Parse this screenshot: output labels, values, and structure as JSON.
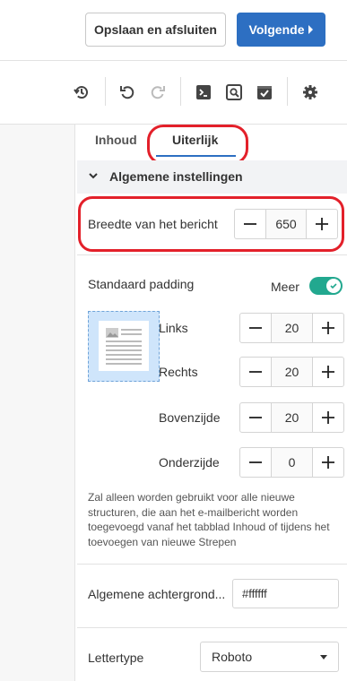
{
  "header": {
    "save_label": "Opslaan en afsluiten",
    "next_label": "Volgende"
  },
  "toolbar": {
    "icons": [
      "history-icon",
      "undo-icon",
      "redo-icon",
      "code-preview-icon",
      "search-preview-icon",
      "test-email-icon",
      "settings-icon"
    ]
  },
  "tabs": [
    {
      "label": "Inhoud",
      "active": false
    },
    {
      "label": "Uiterlijk",
      "active": true
    }
  ],
  "section": {
    "title": "Algemene instellingen"
  },
  "message_width": {
    "label": "Breedte van het bericht",
    "value": "650"
  },
  "padding": {
    "label": "Standaard padding",
    "more_label": "Meer",
    "toggle_on": true,
    "fields": [
      {
        "label": "Links",
        "value": "20"
      },
      {
        "label": "Rechts",
        "value": "20"
      },
      {
        "label": "Bovenzijde",
        "value": "20"
      },
      {
        "label": "Onderzijde",
        "value": "0"
      }
    ],
    "note": "Zal alleen worden gebruikt voor alle nieuwe structuren, die aan het e-mailbericht worden toegevoegd vanaf het tabblad Inhoud of tijdens het toevoegen van nieuwe Strepen"
  },
  "background": {
    "label": "Algemene achtergrond...",
    "value": "#ffffff"
  },
  "font": {
    "label": "Lettertype",
    "value": "Roboto"
  },
  "colors": {
    "accent": "#2d6fc2",
    "toggle": "#22a88f",
    "highlight": "#e3202a"
  }
}
